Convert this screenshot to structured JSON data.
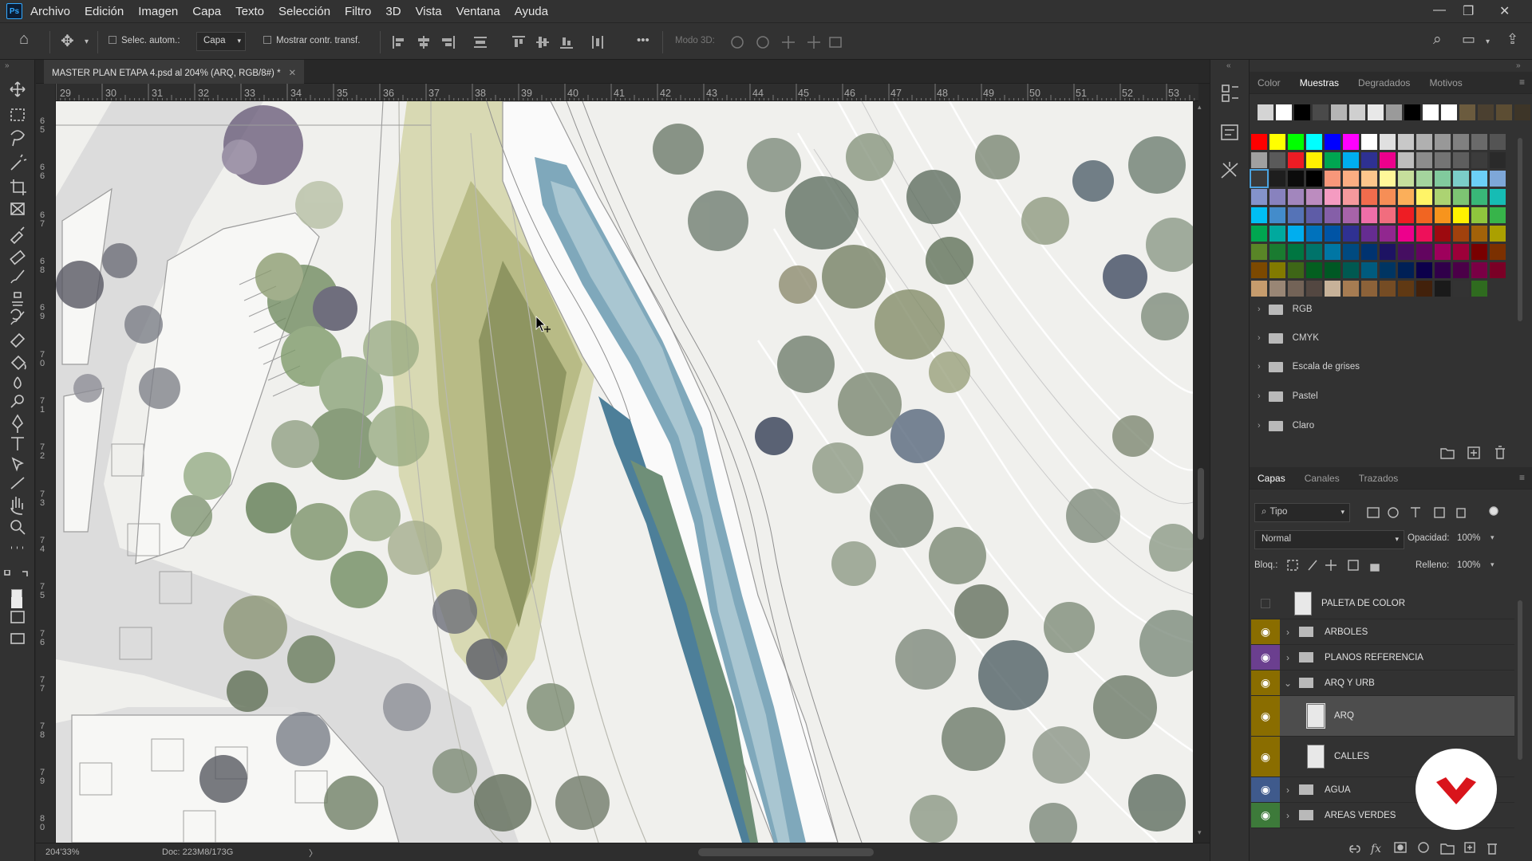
{
  "app": {
    "logo": "Ps",
    "title": "Adobe Photoshop"
  },
  "menu": [
    "Archivo",
    "Edición",
    "Imagen",
    "Capa",
    "Texto",
    "Selección",
    "Filtro",
    "3D",
    "Vista",
    "Ventana",
    "Ayuda"
  ],
  "window_controls": {
    "minimize": "—",
    "restore": "❐",
    "close": "✕"
  },
  "options_bar": {
    "auto_select_label": "Selec. autom.:",
    "auto_select_value": "Capa",
    "show_transform_label": "Mostrar contr. transf.",
    "mode3d_label": "Modo 3D:",
    "more": "•••"
  },
  "document": {
    "tab_title": "MASTER PLAN ETAPA 4.psd al 204% (ARQ, RGB/8#) *",
    "close": "✕"
  },
  "ruler": {
    "top": [
      "29",
      "30",
      "31",
      "32",
      "33",
      "34",
      "35",
      "36",
      "37",
      "38",
      "39",
      "40",
      "41",
      "42",
      "43",
      "44",
      "45",
      "46",
      "47",
      "48",
      "49",
      "50",
      "51",
      "52",
      "53"
    ],
    "left": [
      "6 5",
      "6 6",
      "6 7",
      "6 8",
      "6 9",
      "7 0",
      "7 1",
      "7 2",
      "7 3",
      "7 4",
      "7 5",
      "7 6",
      "7 7",
      "7 8",
      "7 9",
      "8 0"
    ]
  },
  "status": {
    "zoom": "204'33%",
    "doc": "Doc: 223M8/173G",
    "arrow": "〉"
  },
  "swatches_panel": {
    "tabs": [
      "Color",
      "Muestras",
      "Degradados",
      "Motivos"
    ],
    "active_tab": "Muestras",
    "groups": [
      "RGB",
      "CMYK",
      "Escala de grises",
      "Pastel",
      "Claro"
    ],
    "recent": [
      "#d4d4d4",
      "#ffffff",
      "#000000",
      "#4a4a4a",
      "#b5b5b5",
      "#cfcfcf",
      "#e8e8e8",
      "#9a9a9a",
      "#000000",
      "#ffffff",
      "#ffffff",
      "#6b5b3e",
      "#4b4030",
      "#5c4d33",
      "#3d3528",
      "#4a3f2e"
    ],
    "grid": [
      [
        "#ff0000",
        "#ffff00",
        "#00ff00",
        "#00ffff",
        "#0000ff",
        "#ff00ff",
        "#ffffff",
        "#e0e0e0",
        "#c8c8c8",
        "#b0b0b0",
        "#989898",
        "#808080",
        "#6a6a6a",
        "#545454"
      ],
      [
        "#a0a0a0",
        "#5a5a5a",
        "#ed1c24",
        "#fff200",
        "#00a651",
        "#00aeef",
        "#2e3192",
        "#ec008c",
        "#bdbdbd",
        "#8c8c8c",
        "#747474",
        "#5e5e5e",
        "#3c3c3c",
        "#2a2a2a"
      ],
      [
        "#3a3a3a",
        "#1e1e1e",
        "#0c0c0c",
        "#000000",
        "#f7977a",
        "#fbad82",
        "#fdc68c",
        "#fff799",
        "#c6df9c",
        "#a4d49d",
        "#81ca9d",
        "#7bcdc8",
        "#6ccff7",
        "#7ea7d8"
      ],
      [
        "#8493ca",
        "#8882be",
        "#a286bd",
        "#bc8cbf",
        "#f49bc1",
        "#f5999d",
        "#f16c4d",
        "#f68e56",
        "#fbaf5a",
        "#fff467",
        "#acd372",
        "#7dc473",
        "#39b778",
        "#16bcb4"
      ],
      [
        "#00bff3",
        "#438ccb",
        "#5573b7",
        "#5e5ca7",
        "#855fa8",
        "#a763a9",
        "#ef6ea8",
        "#f16d7e",
        "#ee1d24",
        "#f16522",
        "#f7941d",
        "#fff100",
        "#8fc63d",
        "#37b44a"
      ],
      [
        "#00a650",
        "#00a99e",
        "#00aeef",
        "#0072bc",
        "#0054a5",
        "#2f3192",
        "#652c91",
        "#91278f",
        "#ed008c",
        "#ee105a",
        "#9d0a0f",
        "#a1410d",
        "#a36209",
        "#aba000"
      ],
      [
        "#598527",
        "#1a7b30",
        "#007641",
        "#00736a",
        "#0076a4",
        "#004a80",
        "#003370",
        "#1d1363",
        "#450e61",
        "#62055f",
        "#9e005c",
        "#9d0039",
        "#790000",
        "#7b3000"
      ],
      [
        "#7c4900",
        "#827a00",
        "#3e6617",
        "#045f20",
        "#005824",
        "#005951",
        "#005b7e",
        "#003562",
        "#002056",
        "#0c004b",
        "#30004a",
        "#4b0048",
        "#7a0045",
        "#7a0026"
      ],
      [
        "#c69c6d",
        "#998675",
        "#736357",
        "#534741",
        "#c7b299",
        "#a67c52",
        "#8c6239",
        "#754c24",
        "#603913",
        "#42210b",
        "#1a1a1a",
        "#333333",
        "#2f6b1f",
        null
      ]
    ]
  },
  "layers_panel": {
    "tabs": [
      "Capas",
      "Canales",
      "Trazados"
    ],
    "active_tab": "Capas",
    "filter_label": "Tipo",
    "blend_mode": "Normal",
    "opacity_label": "Opacidad:",
    "opacity_value": "100%",
    "lock_label": "Bloq.:",
    "fill_label": "Relleno:",
    "fill_value": "100%",
    "layers": [
      {
        "name": "PALETA DE COLOR",
        "visible": false,
        "type": "layer",
        "eye_color": null,
        "selected": false
      },
      {
        "name": "ARBOLES",
        "visible": true,
        "type": "group",
        "eye_color": "#8a6d00",
        "selected": false,
        "expanded": false
      },
      {
        "name": "PLANOS REFERENCIA",
        "visible": true,
        "type": "group",
        "eye_color": "#6b3f8f",
        "selected": false,
        "expanded": false
      },
      {
        "name": "ARQ Y URB",
        "visible": true,
        "type": "group",
        "eye_color": "#8a6d00",
        "selected": false,
        "expanded": true
      },
      {
        "name": "ARQ",
        "visible": true,
        "type": "layer",
        "eye_color": "#8a6d00",
        "selected": true
      },
      {
        "name": "CALLES",
        "visible": true,
        "type": "layer",
        "eye_color": "#8a6d00",
        "selected": false
      },
      {
        "name": "AGUA",
        "visible": true,
        "type": "group",
        "eye_color": "#3f5a8c",
        "selected": false,
        "expanded": false
      },
      {
        "name": "AREAS VERDES",
        "visible": true,
        "type": "group",
        "eye_color": "#3d7a3a",
        "selected": false,
        "expanded": false
      }
    ]
  },
  "icons": {
    "home": "⌂",
    "move": "✥",
    "search": "⌕",
    "workspace": "▭",
    "share": "⇪",
    "panel_collapse": "»",
    "panel_menu": "≡"
  },
  "tools": [
    "move",
    "marquee",
    "lasso",
    "magic-wand",
    "crop",
    "frame",
    "eyedropper",
    "healing",
    "brush",
    "stamp",
    "history-brush",
    "eraser",
    "paint-bucket",
    "blur",
    "dodge",
    "pen",
    "type",
    "path-select",
    "line",
    "hand",
    "zoom",
    "more",
    "colors",
    "quick-mask",
    "screen-mode"
  ],
  "colors": {
    "foreground": "#ebebeb",
    "background": "#000000",
    "selected_row": "#4d4d4d"
  }
}
